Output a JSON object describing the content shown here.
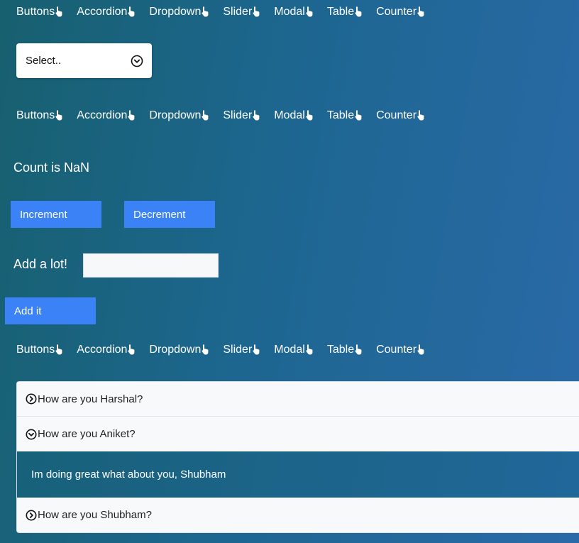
{
  "nav": {
    "items": [
      "Buttons",
      "Accordion",
      "Dropdown",
      "Slider",
      "Modal",
      "Table",
      "Counter"
    ],
    "icon": "pointing-hand-icon"
  },
  "dropdown": {
    "label": "Select..",
    "icon": "chevron-down-circle-icon"
  },
  "counter": {
    "count_text": "Count is NaN",
    "increment_label": "Increment",
    "decrement_label": "Decrement",
    "add_label": "Add a lot!",
    "add_value": "",
    "add_button_label": "Add it"
  },
  "accordion": {
    "items": [
      {
        "question": "How are you Harshal?",
        "open": false
      },
      {
        "question": "How are you Aniket?",
        "open": true,
        "answer": "Im doing great what about you, Shubham"
      },
      {
        "question": "How are you Shubham?",
        "open": false
      }
    ]
  },
  "colors": {
    "button": "#3b82f6",
    "bg_start": "#17606f",
    "bg_end": "#2a6aa8"
  }
}
